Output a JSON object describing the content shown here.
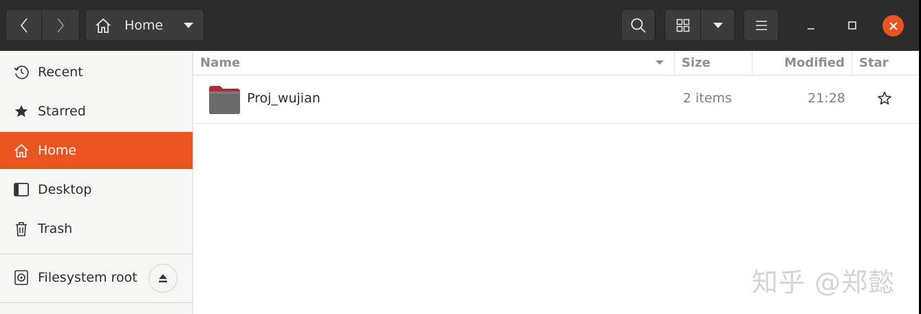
{
  "header": {
    "path_label": "Home"
  },
  "sidebar": {
    "items": [
      {
        "label": "Recent",
        "icon": "clock-icon"
      },
      {
        "label": "Starred",
        "icon": "star-icon"
      },
      {
        "label": "Home",
        "icon": "home-icon",
        "active": true
      },
      {
        "label": "Desktop",
        "icon": "desktop-icon"
      },
      {
        "label": "Trash",
        "icon": "trash-icon"
      }
    ],
    "devices": [
      {
        "label": "Filesystem root",
        "icon": "drive-icon"
      }
    ]
  },
  "columns": {
    "name": "Name",
    "size": "Size",
    "modified": "Modified",
    "star": "Star"
  },
  "files": [
    {
      "name": "Proj_wujian",
      "size": "2 items",
      "modified": "21:28",
      "icon": "folder-icon"
    }
  ],
  "watermark": "知乎 @郑懿",
  "colors": {
    "accent": "#e95420",
    "headerbar": "#2c2c2c",
    "sidebar": "#f6f6f5"
  }
}
